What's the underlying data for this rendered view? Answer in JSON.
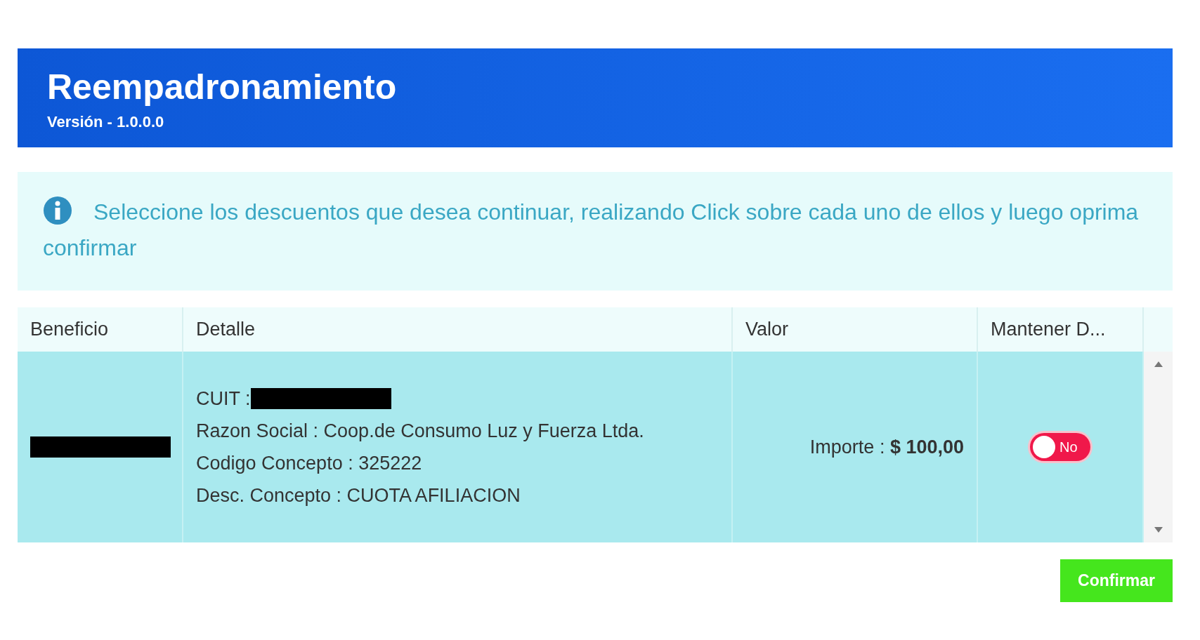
{
  "header": {
    "title": "Reempadronamiento",
    "version": "Versión - 1.0.0.0"
  },
  "info": {
    "message": "Seleccione los descuentos que desea continuar, realizando Click sobre cada uno de ellos y luego oprima confirmar"
  },
  "table": {
    "columns": [
      "Beneficio",
      "Detalle",
      "Valor",
      "Mantener D..."
    ],
    "rows": [
      {
        "beneficio_redacted": true,
        "detail": [
          {
            "text": "CUIT : ",
            "redacted": true
          },
          {
            "text": "Razon Social : Coop.de Consumo Luz y Fuerza Ltda.",
            "redacted": false
          },
          {
            "text": "Codigo Concepto : 325222",
            "redacted": false
          },
          {
            "text": "Desc. Concepto : CUOTA AFILIACION",
            "redacted": false
          }
        ],
        "value_label": "Importe : ",
        "value_amount": "$ 100,00",
        "keep": {
          "on": false,
          "label": "No"
        }
      }
    ]
  },
  "confirm_button": "Confirmar"
}
